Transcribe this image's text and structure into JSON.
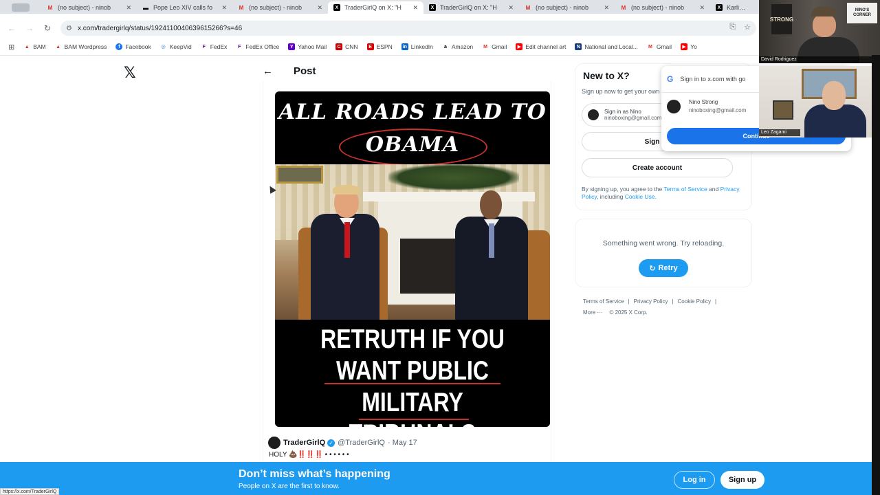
{
  "browser": {
    "tabs": [
      {
        "title": "(no subject) - ninob",
        "icon": "gmail-icon",
        "active": false
      },
      {
        "title": "Pope Leo XIV calls fo",
        "icon": "news-icon",
        "active": false
      },
      {
        "title": "(no subject) - ninob",
        "icon": "gmail-icon",
        "active": false
      },
      {
        "title": "TraderGirlQ on X: \"H",
        "icon": "x-icon",
        "active": true
      },
      {
        "title": "TraderGirlQ on X: \"H",
        "icon": "x-icon",
        "active": false
      },
      {
        "title": "(no subject) - ninob",
        "icon": "gmail-icon",
        "active": false
      },
      {
        "title": "(no subject) - ninob",
        "icon": "gmail-icon",
        "active": false
      },
      {
        "title": "Karli Bo",
        "icon": "x-icon",
        "active": false
      }
    ],
    "url": "x.com/tradergirlq/status/1924110040639615266?s=46",
    "bookmarks": [
      {
        "label": "BAM",
        "icon": "bam-icon"
      },
      {
        "label": "BAM Wordpress",
        "icon": "bam-icon"
      },
      {
        "label": "Facebook",
        "icon": "facebook-icon"
      },
      {
        "label": "KeepVid",
        "icon": "keepvid-icon"
      },
      {
        "label": "FedEx",
        "icon": "fedex-icon"
      },
      {
        "label": "FedEx Office",
        "icon": "fedex-icon"
      },
      {
        "label": "Yahoo Mail",
        "icon": "yahoo-icon"
      },
      {
        "label": "CNN",
        "icon": "cnn-icon"
      },
      {
        "label": "ESPN",
        "icon": "espn-icon"
      },
      {
        "label": "LinkedIn",
        "icon": "linkedin-icon"
      },
      {
        "label": "Amazon",
        "icon": "amazon-icon"
      },
      {
        "label": "Gmail",
        "icon": "gmail-icon"
      },
      {
        "label": "Edit channel art",
        "icon": "youtube-icon"
      },
      {
        "label": "National and Local...",
        "icon": "news-icon"
      },
      {
        "label": "Gmail",
        "icon": "gmail-icon"
      },
      {
        "label": "Yo",
        "icon": "youtube-icon"
      }
    ],
    "status_url": "https://x.com/TraderGirlQ"
  },
  "x": {
    "logo": "𝕏",
    "post_header": "Post",
    "meme": {
      "top_line1": "ALL ROADS LEAD TO",
      "top_line2": "OBAMA",
      "bottom_text": "RETRUTH IF YOU WANT PUBLIC MILITARY TRIBUNALS"
    },
    "tweet": {
      "name": "TraderGirlQ",
      "handle": "@TraderGirlQ",
      "date": "· May 17",
      "text": "HOLY 💩‼️‼️‼️ • • • • • •"
    },
    "sidebar": {
      "title": "New to X?",
      "subtitle": "Sign up now to get your own",
      "google_signin": "Sign in as Nino",
      "google_email": "ninoboxing@gmail.com",
      "apple_button": " Sign up",
      "create_account": "Create account",
      "legal_prefix": "By signing up, you agree to the ",
      "terms": "Terms of Service",
      "and": " and ",
      "privacy": "Privacy Policy",
      "including": ", including ",
      "cookie": "Cookie Use.",
      "error_text": "Something went wrong. Try reloading.",
      "retry": "Retry",
      "footer": [
        "Terms of Service",
        "Privacy Policy",
        "Cookie Policy"
      ],
      "more": "More ···",
      "copyright": "© 2025 X Corp."
    },
    "google_popup": {
      "header": "Sign in to x.com with go",
      "account_name": "Nino Strong",
      "account_email": "ninoboxing@gmail.com",
      "continue": "Continue"
    },
    "banner": {
      "title": "Don’t miss what’s happening",
      "subtitle": "People on X are the first to know.",
      "login": "Log in",
      "signup": "Sign up"
    }
  },
  "webcams": {
    "cam1_label": "David Rodriguez",
    "cam1_sign": "STRONG",
    "cam1_sign2": "NINO'S CORNER",
    "cam2_label": "Leo Zagami"
  },
  "colors": {
    "x_blue": "#1d9bf0",
    "google_blue": "#1a73e8",
    "meme_red": "#c8322c"
  }
}
